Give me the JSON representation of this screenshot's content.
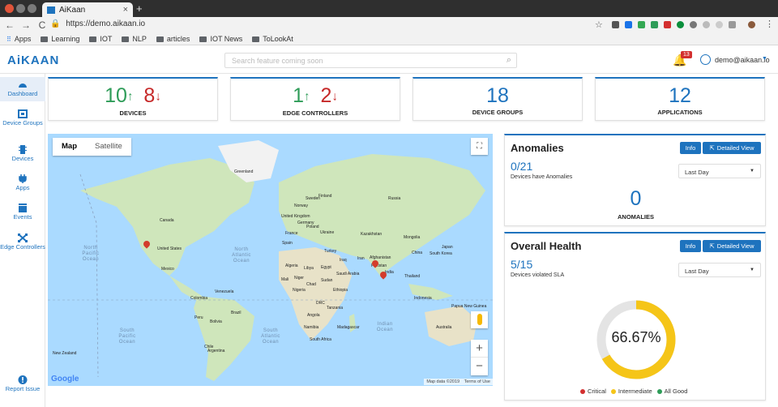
{
  "browser": {
    "tab_title": "AiKaan",
    "url": "https://demo.aikaan.io",
    "bookmarks": [
      {
        "label": "Apps"
      },
      {
        "label": "Learning"
      },
      {
        "label": "IOT"
      },
      {
        "label": "NLP"
      },
      {
        "label": "articles"
      },
      {
        "label": "IOT News"
      },
      {
        "label": "ToLookAt"
      }
    ]
  },
  "header": {
    "logo": "AiKAAN",
    "search_placeholder": "Search feature coming soon",
    "notification_count": "13",
    "username": "demo@aikaan.io"
  },
  "sidebar": {
    "items": [
      {
        "label": "Dashboard",
        "icon": "dashboard-icon"
      },
      {
        "label": "Device Groups",
        "icon": "device-groups-icon"
      },
      {
        "label": "Devices",
        "icon": "devices-icon"
      },
      {
        "label": "Apps",
        "icon": "apps-icon"
      },
      {
        "label": "Events",
        "icon": "events-icon"
      },
      {
        "label": "Edge Controllers",
        "icon": "edge-controllers-icon"
      },
      {
        "label": "Report Issue",
        "icon": "report-issue-icon"
      }
    ]
  },
  "stats": {
    "devices": {
      "up": "10",
      "down": "8",
      "label": "DEVICES"
    },
    "edge": {
      "up": "1",
      "down": "2",
      "label": "EDGE CONTROLLERS"
    },
    "groups": {
      "value": "18",
      "label": "DEVICE GROUPS"
    },
    "apps": {
      "value": "12",
      "label": "APPLICATIONS"
    }
  },
  "map": {
    "tab_map": "Map",
    "tab_satellite": "Satellite",
    "google": "Google",
    "footer_data": "Map data ©2019",
    "footer_terms": "Terms of Use",
    "labels": {
      "greenland": "Greenland",
      "canada": "Canada",
      "us": "United States",
      "mexico": "Mexico",
      "venezuela": "Venezuela",
      "colombia": "Colombia",
      "peru": "Peru",
      "brazil": "Brazil",
      "bolivia": "Bolivia",
      "chile": "Chile",
      "argentina": "Argentina",
      "russia": "Russia",
      "kazakhstan": "Kazakhstan",
      "mongolia": "Mongolia",
      "china": "China",
      "india": "India",
      "iran": "Iran",
      "turkey": "Turkey",
      "sweden": "Sweden",
      "finland": "Finland",
      "norway": "Norway",
      "ukraine": "Ukraine",
      "afghanistan": "Afghanistan",
      "pakistan": "Pakistan",
      "algeria": "Algeria",
      "libya": "Libya",
      "egypt": "Egypt",
      "mali": "Mali",
      "niger": "Niger",
      "chad": "Chad",
      "sudan": "Sudan",
      "nigeria": "Nigeria",
      "ethiopia": "Ethiopia",
      "drc": "DRC",
      "tanzania": "Tanzania",
      "angola": "Angola",
      "namibia": "Namibia",
      "southafrica": "South Africa",
      "madagascar": "Madagascar",
      "thailand": "Thailand",
      "indonesia": "Indonesia",
      "southkorea": "South Korea",
      "japan": "Japan",
      "australia": "Australia",
      "newzealand": "New Zealand",
      "papua": "Papua New Guinea",
      "saudi": "Saudi Arabia",
      "iraq": "Iraq",
      "uk": "United Kingdom",
      "germany": "Germany",
      "spain": "Spain",
      "france": "France",
      "poland": "Poland"
    },
    "oceans": {
      "npac": "North Pacific Ocean",
      "natl": "North Atlantic Ocean",
      "spac": "South Pacific Ocean",
      "satl": "South Atlantic Ocean",
      "indian": "Indian Ocean"
    }
  },
  "anomalies": {
    "title": "Anomalies",
    "info": "Info",
    "detailed": "Detailed View",
    "ratio": "0/21",
    "sub": "Devices have Anomalies",
    "range": "Last Day",
    "count": "0",
    "count_label": "ANOMALIES"
  },
  "health": {
    "title": "Overall Health",
    "info": "Info",
    "detailed": "Detailed View",
    "ratio": "5/15",
    "sub": "Devices violated SLA",
    "range": "Last Day",
    "percent": "66.67%",
    "percent_value": 66.67,
    "legend": [
      "Critical",
      "Intermediate",
      "All Good"
    ]
  },
  "colors": {
    "accent": "#1e73be",
    "up": "#2e9c58",
    "down": "#c62828",
    "critical": "#d32f2f",
    "intermediate": "#f5c518",
    "good": "#2e9c58"
  }
}
